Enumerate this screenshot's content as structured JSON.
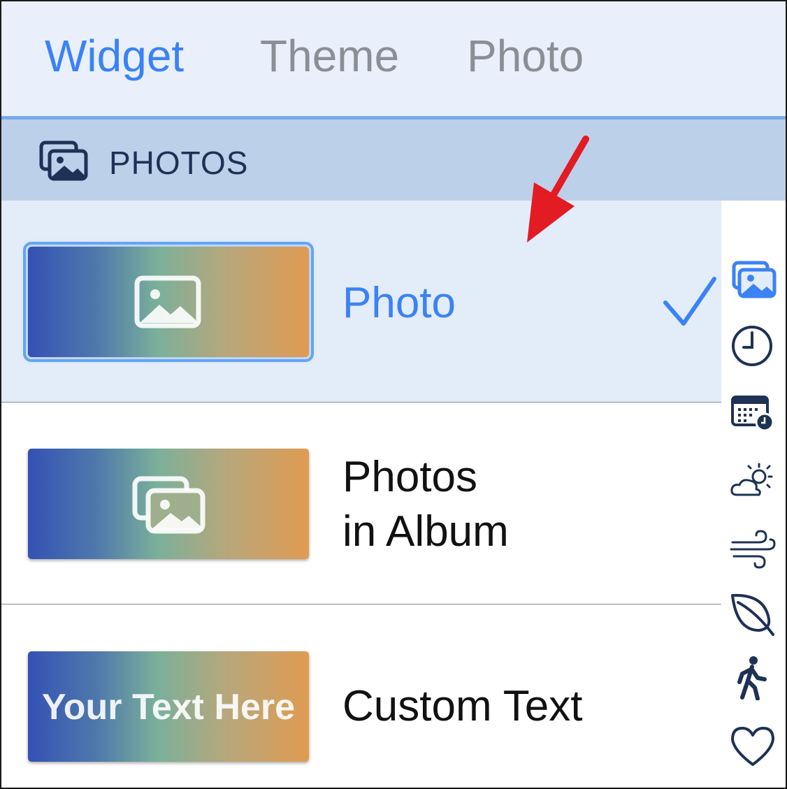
{
  "tabs": [
    {
      "label": "Widget",
      "active": true
    },
    {
      "label": "Theme",
      "active": false
    },
    {
      "label": "Photo",
      "active": false
    }
  ],
  "section": {
    "title": "PHOTOS",
    "icon": "photos-stack-icon"
  },
  "rows": [
    {
      "label": "Photo",
      "thumb_icon": "image-icon",
      "selected": true
    },
    {
      "label_line1": "Photos",
      "label_line2": "in Album",
      "thumb_icon": "photos-stack-icon",
      "selected": false
    },
    {
      "label": "Custom Text",
      "thumb_text": "Your Text Here",
      "selected": false
    }
  ],
  "rail_icons": [
    "photos-stack-icon",
    "clock-icon",
    "calendar-clock-icon",
    "partly-sunny-icon",
    "wind-icon",
    "leaf-icon",
    "walking-icon",
    "heart-icon"
  ],
  "colors": {
    "accent": "#3b82f6",
    "annotation_arrow": "#e31b23"
  }
}
